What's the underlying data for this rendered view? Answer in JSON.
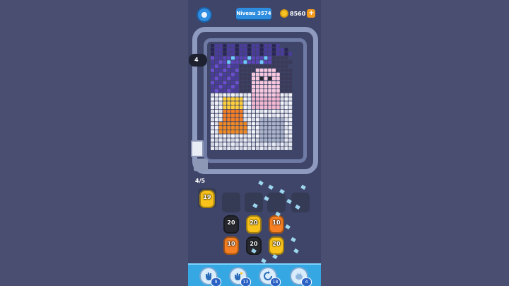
{
  "header": {
    "level_label": "Niveau 3574",
    "coins": "8560",
    "add_coins_label": "+"
  },
  "board": {
    "pig_count": "4"
  },
  "progress": "4/5",
  "pigs": {
    "top_slot": "19",
    "row1": [
      "20",
      "20",
      "10"
    ],
    "row2": [
      "10",
      "20",
      "20"
    ]
  },
  "toolbar": {
    "items": [
      {
        "icon": "hand-icon",
        "badge": "9"
      },
      {
        "icon": "shuffle-hand-icon",
        "badge": "13"
      },
      {
        "icon": "refresh-icon",
        "badge": "18"
      },
      {
        "icon": "pig-icon",
        "badge": "4"
      }
    ]
  },
  "colors": {
    "accent": "#2f8de0",
    "coin": "#f7c324",
    "yellow_pig": "#f8c21b",
    "black_pig": "#27282f",
    "orange_pig": "#f57f22",
    "toolbar": "#35a8e4"
  }
}
